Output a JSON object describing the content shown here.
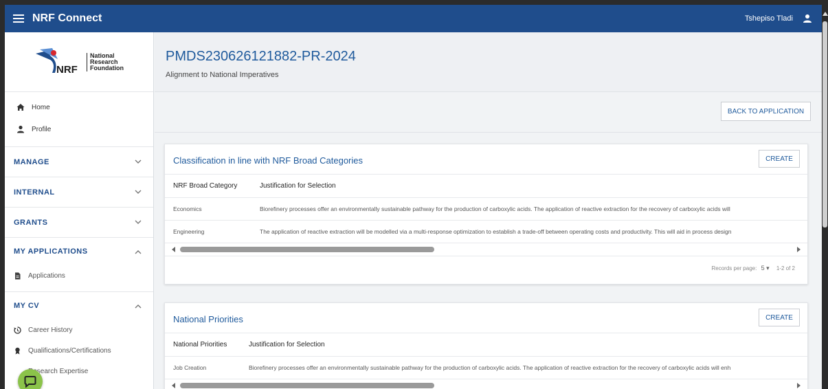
{
  "topbar": {
    "app_title": "NRF Connect",
    "user_name": "Tshepiso Tladi",
    "menu_icon": "hamburger-icon",
    "user_icon": "user-icon"
  },
  "logo": {
    "text_line1": "National",
    "text_line2": "Research",
    "text_line3": "Foundation",
    "mark_text": "NRF"
  },
  "sidebar": {
    "home": "Home",
    "profile": "Profile",
    "sections": {
      "manage": "MANAGE",
      "internal": "INTERNAL",
      "grants": "GRANTS",
      "my_applications": "MY APPLICATIONS",
      "my_cv": "MY CV"
    },
    "applications": "Applications",
    "career_history": "Career History",
    "qualifications": "Qualifications/Certifications",
    "research_expertise": "Research Expertise"
  },
  "header": {
    "title": "PMDS230626121882-PR-2024",
    "subtitle": "Alignment to National Imperatives",
    "back_button": "BACK TO APPLICATION"
  },
  "card1": {
    "title": "Classification in line with NRF Broad Categories",
    "create": "CREATE",
    "col1": "NRF Broad Category",
    "col2": "Justification for Selection",
    "rows": [
      {
        "category": "Economics",
        "justification": "Biorefinery processes offer an environmentally sustainable pathway for the production of carboxylic acids. The application of reactive extraction for the recovery of carboxylic acids will"
      },
      {
        "category": "Engineering",
        "justification": "The application of reactive extraction will be modelled via a multi-response optimization to establish a trade-off between operating costs and productivity. This will aid in process design"
      }
    ],
    "records_per_page_label": "Records per page:",
    "records_per_page_value": "5",
    "range": "1-2 of 2"
  },
  "card2": {
    "title": "National Priorities",
    "create": "CREATE",
    "col1": "National Priorities",
    "col2": "Justification for Selection",
    "rows": [
      {
        "priority": "Job Creation",
        "justification": "Biorefinery processes offer an environmentally sustainable pathway for the production of carboxylic acids. The application of reactive extraction for the recovery of carboxylic acids will enh"
      }
    ]
  },
  "colors": {
    "topbar": "#1f4d8c",
    "accent": "#1f5a9c",
    "fab": "#8bc34a"
  }
}
